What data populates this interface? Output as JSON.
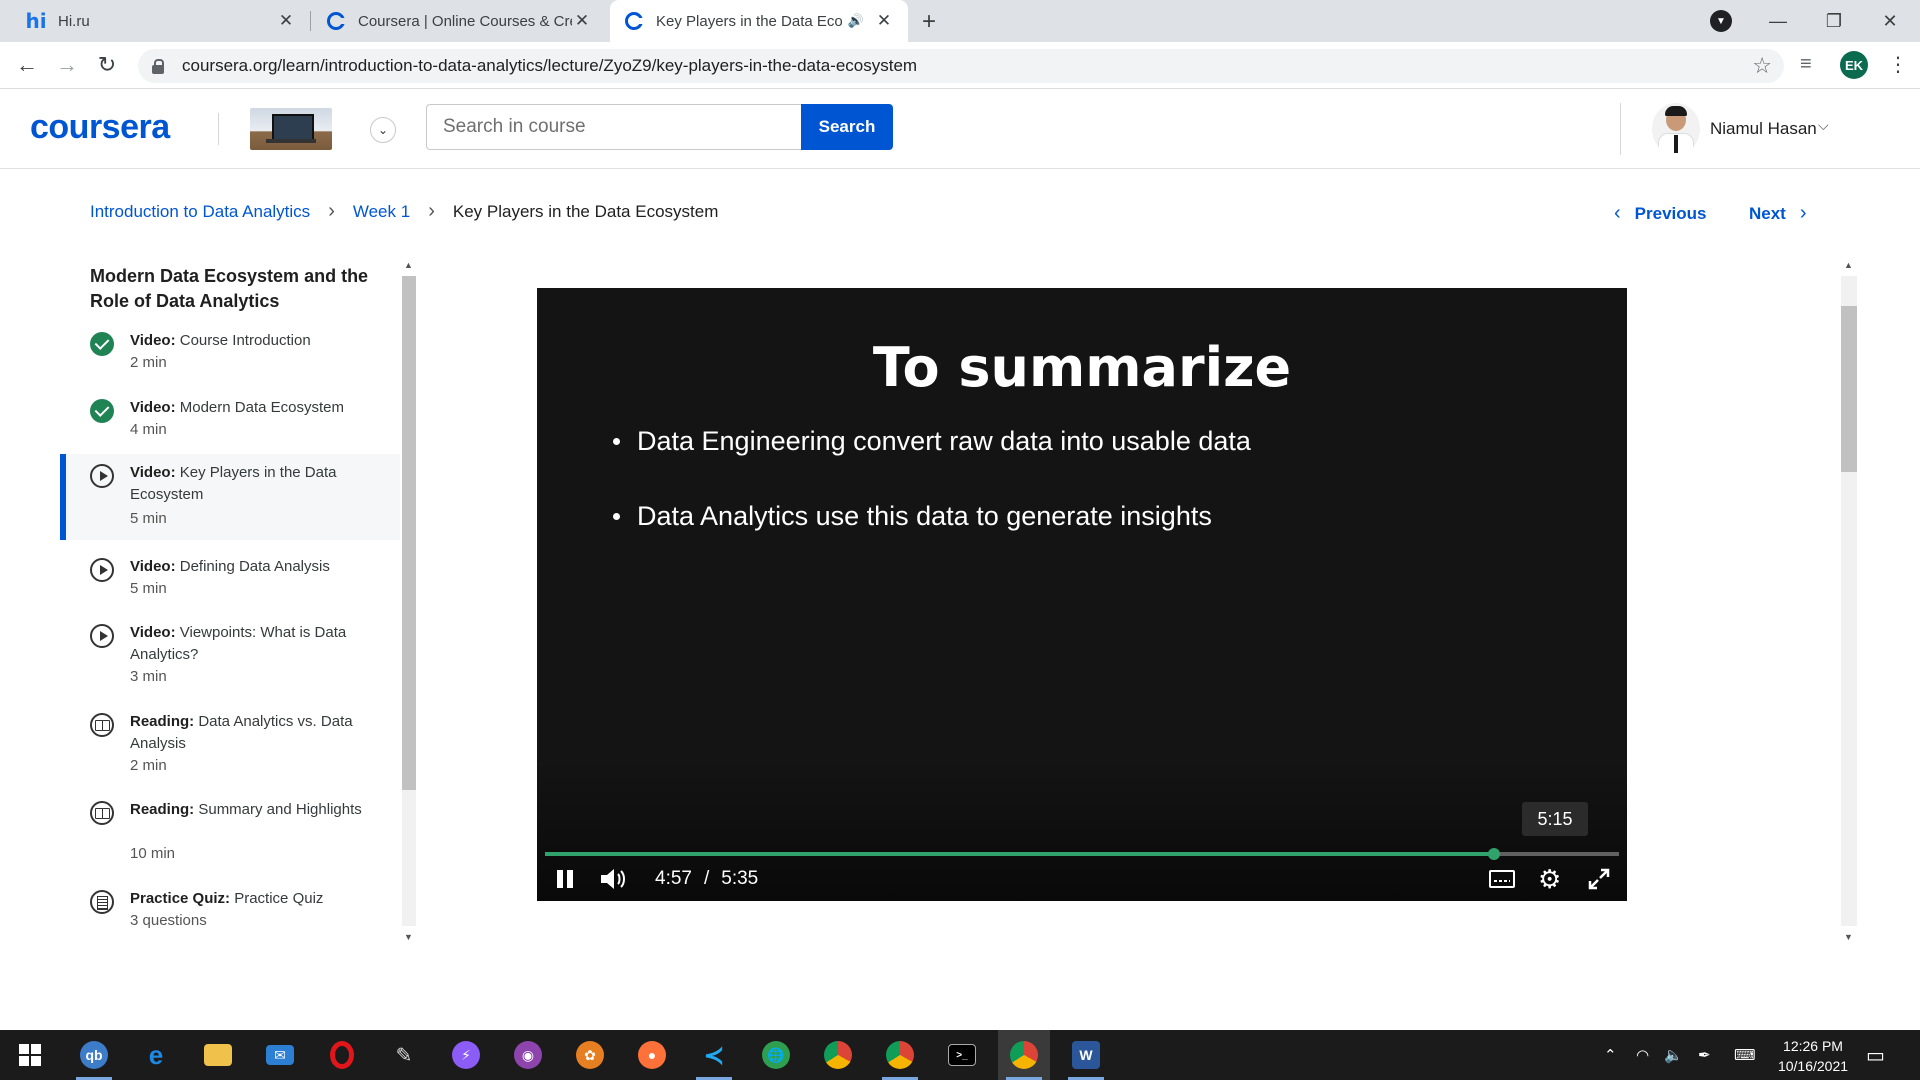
{
  "browser": {
    "tabs": [
      {
        "title": "Hi.ru",
        "favicon": "hi-icon"
      },
      {
        "title": "Coursera | Online Courses & Cred",
        "favicon": "coursera-icon"
      },
      {
        "title": "Key Players in the Data Ecosys",
        "favicon": "coursera-icon",
        "active": true,
        "audio": true
      }
    ],
    "url": "coursera.org/learn/introduction-to-data-analytics/lecture/ZyoZ9/key-players-in-the-data-ecosystem",
    "profile_initials": "EK"
  },
  "header": {
    "logo": "coursera",
    "search_placeholder": "Search in course",
    "search_button": "Search",
    "user_name": "Niamul Hasan"
  },
  "breadcrumb": {
    "course": "Introduction to Data Analytics",
    "week": "Week 1",
    "current": "Key Players in the Data Ecosystem"
  },
  "nav": {
    "previous": "Previous",
    "next": "Next"
  },
  "sidebar": {
    "module_title": "Modern Data Ecosystem and the Role of Data Analytics",
    "items": [
      {
        "type": "Video:",
        "title": "Course Introduction",
        "duration": "2 min",
        "status": "completed"
      },
      {
        "type": "Video:",
        "title": "Modern Data Ecosystem",
        "duration": "4 min",
        "status": "completed"
      },
      {
        "type": "Video:",
        "title": "Key Players in the Data Ecosystem",
        "duration": "5 min",
        "status": "current"
      },
      {
        "type": "Video:",
        "title": "Defining Data Analysis",
        "duration": "5 min",
        "status": "video"
      },
      {
        "type": "Video:",
        "title": "Viewpoints: What is Data Analytics?",
        "duration": "3 min",
        "status": "video"
      },
      {
        "type": "Reading:",
        "title": "Data Analytics vs. Data Analysis",
        "duration": "2 min",
        "status": "reading"
      },
      {
        "type": "Reading:",
        "title": "Summary and Highlights",
        "duration": "10 min",
        "status": "reading"
      },
      {
        "type": "Practice Quiz:",
        "title": "Practice Quiz",
        "duration": "3 questions",
        "status": "quiz"
      }
    ]
  },
  "video": {
    "slide_title": "To summarize",
    "bullets": [
      "Data Engineering convert raw data into usable data",
      "Data Analytics use this data to generate insights"
    ],
    "current_time": "4:57",
    "separator": "/",
    "duration": "5:35",
    "hover_time": "5:15",
    "progress_fraction": 0.884
  },
  "taskbar": {
    "time": "12:26 PM",
    "date": "10/16/2021"
  },
  "colors": {
    "brand": "#0056d2",
    "progress": "#2fa36b",
    "complete": "#1f8354"
  }
}
